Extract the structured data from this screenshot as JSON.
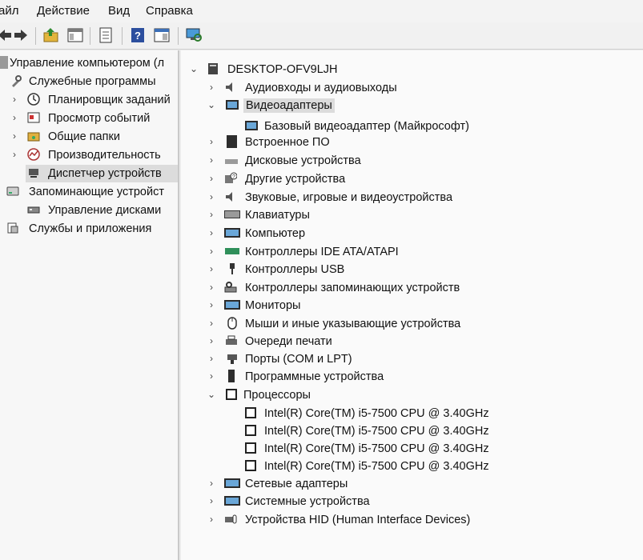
{
  "menubar": {
    "items": [
      "айл",
      "Действие",
      "Вид",
      "Справка"
    ]
  },
  "toolbar": {
    "buttons": [
      "back-arrow-icon",
      "forward-arrow-icon",
      "up-folder-icon",
      "console-tree-icon",
      "properties-icon",
      "help-icon",
      "action-pane-icon",
      "scan-hardware-icon"
    ]
  },
  "left_tree": {
    "root": "Управление компьютером (л",
    "utilities": "Служебные программы",
    "scheduler": "Планировщик заданий",
    "event_viewer": "Просмотр событий",
    "shared_folders": "Общие папки",
    "performance": "Производительность",
    "device_manager": "Диспетчер устройств",
    "storage": "Запоминающие устройст",
    "disk_management": "Управление дисками",
    "services": "Службы и приложения"
  },
  "device_tree": {
    "computer_name": "DESKTOP-OFV9LJH",
    "categories": [
      {
        "label": "Аудиовходы и аудиовыходы",
        "expanded": false
      },
      {
        "label": "Видеоадаптеры",
        "expanded": true,
        "children": [
          "Базовый видеоадаптер (Майкрософт)"
        ]
      },
      {
        "label": "Встроенное ПО",
        "expanded": false
      },
      {
        "label": "Дисковые устройства",
        "expanded": false
      },
      {
        "label": "Другие устройства",
        "expanded": false
      },
      {
        "label": "Звуковые, игровые и видеоустройства",
        "expanded": false
      },
      {
        "label": "Клавиатуры",
        "expanded": false
      },
      {
        "label": "Компьютер",
        "expanded": false
      },
      {
        "label": "Контроллеры IDE ATA/ATAPI",
        "expanded": false
      },
      {
        "label": "Контроллеры USB",
        "expanded": false
      },
      {
        "label": "Контроллеры запоминающих устройств",
        "expanded": false
      },
      {
        "label": "Мониторы",
        "expanded": false
      },
      {
        "label": "Мыши и иные указывающие устройства",
        "expanded": false
      },
      {
        "label": "Очереди печати",
        "expanded": false
      },
      {
        "label": "Порты (COM и LPT)",
        "expanded": false
      },
      {
        "label": "Программные устройства",
        "expanded": false
      },
      {
        "label": "Процессоры",
        "expanded": true,
        "children": [
          "Intel(R) Core(TM) i5-7500 CPU @ 3.40GHz",
          "Intel(R) Core(TM) i5-7500 CPU @ 3.40GHz",
          "Intel(R) Core(TM) i5-7500 CPU @ 3.40GHz",
          "Intel(R) Core(TM) i5-7500 CPU @ 3.40GHz"
        ]
      },
      {
        "label": "Сетевые адаптеры",
        "expanded": false
      },
      {
        "label": "Системные устройства",
        "expanded": false
      },
      {
        "label": "Устройства HID (Human Interface Devices)",
        "expanded": false
      }
    ]
  },
  "colors": {
    "selection": "#dcdcdc",
    "monitor_icon": "#6aa7d8"
  }
}
